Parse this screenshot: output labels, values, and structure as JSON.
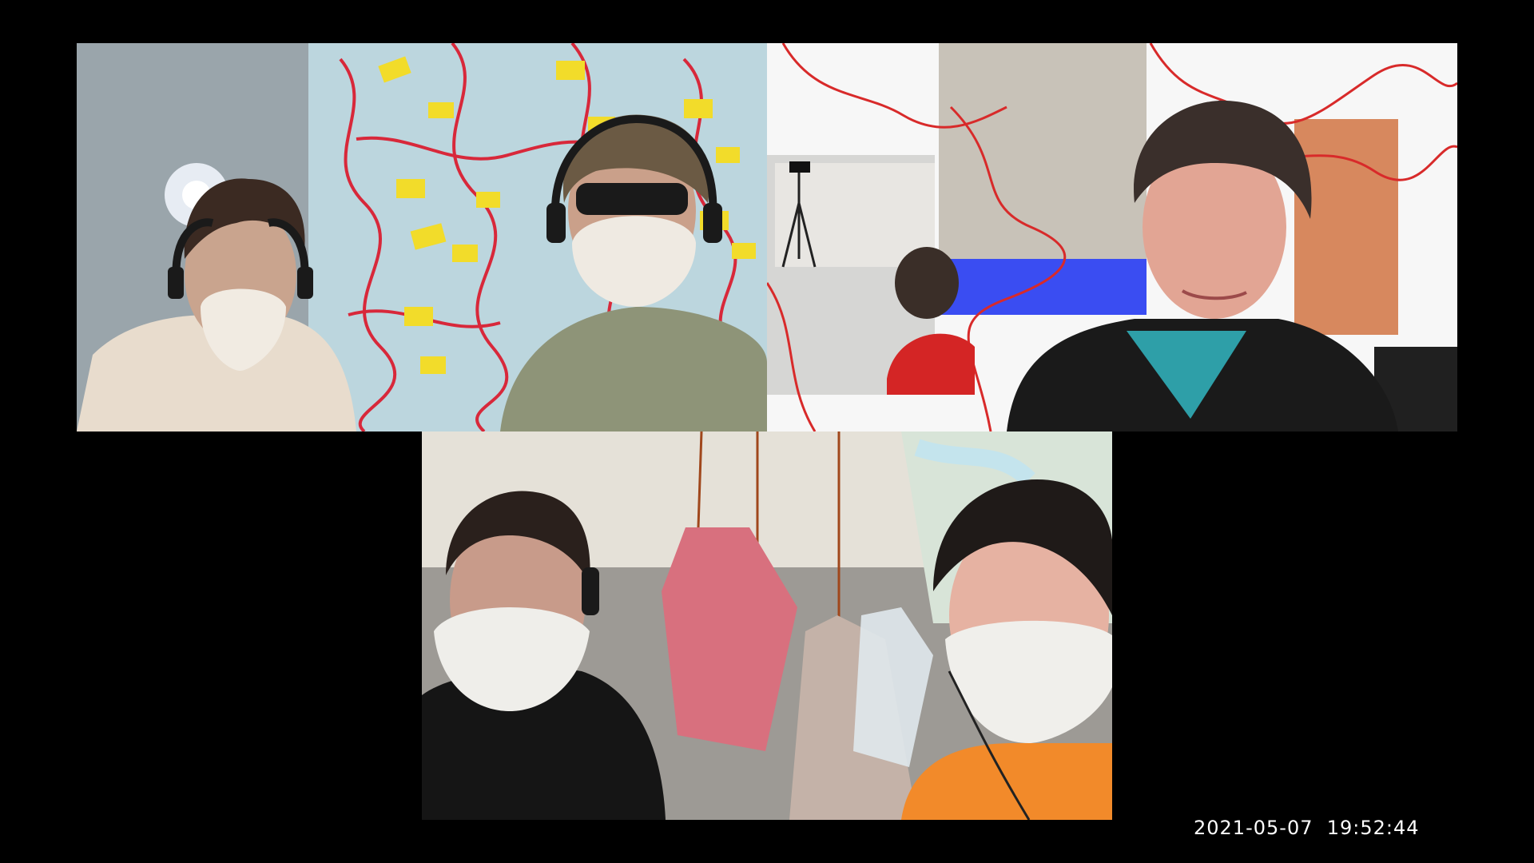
{
  "video_call": {
    "layout": "three-tile gallery",
    "tiles": [
      {
        "participants": 2,
        "icons": [
          "headphones-icon",
          "face-mask-icon"
        ]
      },
      {
        "participants": 1,
        "icons": []
      },
      {
        "participants": 2,
        "icons": [
          "headphones-icon",
          "face-mask-icon"
        ]
      }
    ]
  },
  "overlay": {
    "date": "2021-05-07",
    "time": "19:52:44",
    "timestamp": "2021-05-07  19:52:44"
  },
  "colors": {
    "background": "#000000",
    "wallpaper_blue": "#bcd6de",
    "pattern_red": "#d8283a",
    "pattern_yellow": "#f2dc2a",
    "stripe_blue": "#3a4df2",
    "thread_red": "#d82a2a"
  }
}
